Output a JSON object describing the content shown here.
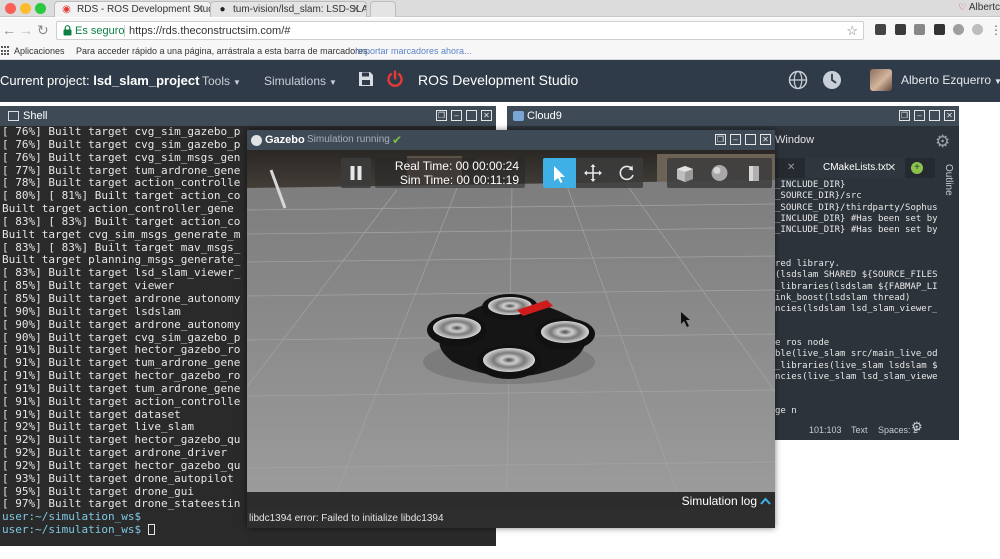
{
  "browser": {
    "tabs": [
      {
        "label": "RDS - ROS Development Studi"
      },
      {
        "label": "tum-vision/lsd_slam: LSD-SLA"
      }
    ],
    "profile_name": "Albertc",
    "secure_label": "Es seguro",
    "url": "https://rds.theconstructsim.com/#",
    "bookmarks": {
      "apps_label": "Aplicaciones",
      "hint": "Para acceder rápido a una página, arrástrala a esta barra de marcadores.",
      "import_link": "Importar marcadores ahora..."
    }
  },
  "header": {
    "project_prefix": "Current project:",
    "project_name": "lsd_slam_project",
    "menu_tools": "Tools",
    "menu_simulations": "Simulations",
    "title": "ROS Development Studio",
    "user_name": "Alberto Ezquerro"
  },
  "shell": {
    "title": "Shell",
    "lines": [
      "[ 76%] Built target cvg_sim_gazebo_p",
      "[ 76%] Built target cvg_sim_gazebo_p",
      "[ 76%] Built target cvg_sim_msgs_gen",
      "[ 77%] Built target tum_ardrone_gene",
      "[ 78%] Built target action_controlle",
      "[ 80%] [ 81%] Built target action_co",
      "Built target action_controller_gene",
      "[ 83%] [ 83%] Built target action_co",
      "Built target cvg_sim_msgs_generate_m",
      "[ 83%] [ 83%] Built target mav_msgs_",
      "Built target planning_msgs_generate_",
      "[ 83%] Built target lsd_slam_viewer_",
      "[ 85%] Built target viewer",
      "[ 85%] Built target ardrone_autonomy",
      "[ 90%] Built target lsdslam",
      "[ 90%] Built target ardrone_autonomy",
      "[ 90%] Built target cvg_sim_gazebo_p",
      "[ 91%] Built target hector_gazebo_ro",
      "[ 91%] Built target tum_ardrone_gene",
      "[ 91%] Built target hector_gazebo_ro",
      "[ 91%] Built target tum_ardrone_gene",
      "[ 91%] Built target action_controlle",
      "[ 91%] Built target dataset",
      "[ 92%] Built target live_slam",
      "[ 92%] Built target hector_gazebo_qu",
      "[ 92%] Built target ardrone_driver",
      "[ 92%] Built target hector_gazebo_qu",
      "[ 93%] Built target drone_autopilot",
      "[ 95%] Built target drone_gui",
      "[ 97%] Built target drone_stateestin"
    ],
    "prompt1": "user:~/simulation_ws$",
    "prompt2": "user:~/simulation_ws$"
  },
  "cloud9": {
    "title": "Cloud9",
    "window_menu": "Window",
    "tab_label": "CMakeLists.txt",
    "outline_label": "Outline",
    "code_lines": [
      "_INCLUDE_DIR}",
      "_SOURCE_DIR}/src",
      "_SOURCE_DIR}/thirdparty/Sophus",
      "_INCLUDE_DIR} #Has been set by",
      "_INCLUDE_DIR} #Has been set by",
      "",
      "",
      "red library.",
      "(lsdslam SHARED ${SOURCE_FILES}",
      "_libraries(lsdslam ${FABMAP_LIB",
      "ink_boost(lsdslam thread)",
      "ncies(lsdslam lsd_slam_viewer_g",
      "",
      "",
      "e ros node",
      "ble(live_slam src/main_live_odo",
      "_libraries(live_slam lsdslam ${",
      "ncies(live_slam lsd_slam_viewer",
      "",
      "",
      "ge n"
    ],
    "status_position": "101:103",
    "status_mode": "Text",
    "status_spaces": "Spaces: 2"
  },
  "gazebo": {
    "title": "Gazebo",
    "status": "Simulation running",
    "real_time": "Real Time: 00 00:00:24",
    "sim_time": "Sim Time: 00 00:11:19",
    "log_label": "Simulation log",
    "log_text": "libdc1394 error: Failed to initialize libdc1394"
  },
  "colors": {
    "header_bg": "#2f3b48",
    "panel_head_bg": "#3e4a56",
    "power_red": "#e53935",
    "select_blue": "#3fb0e6",
    "secure_green": "#0b8043"
  }
}
